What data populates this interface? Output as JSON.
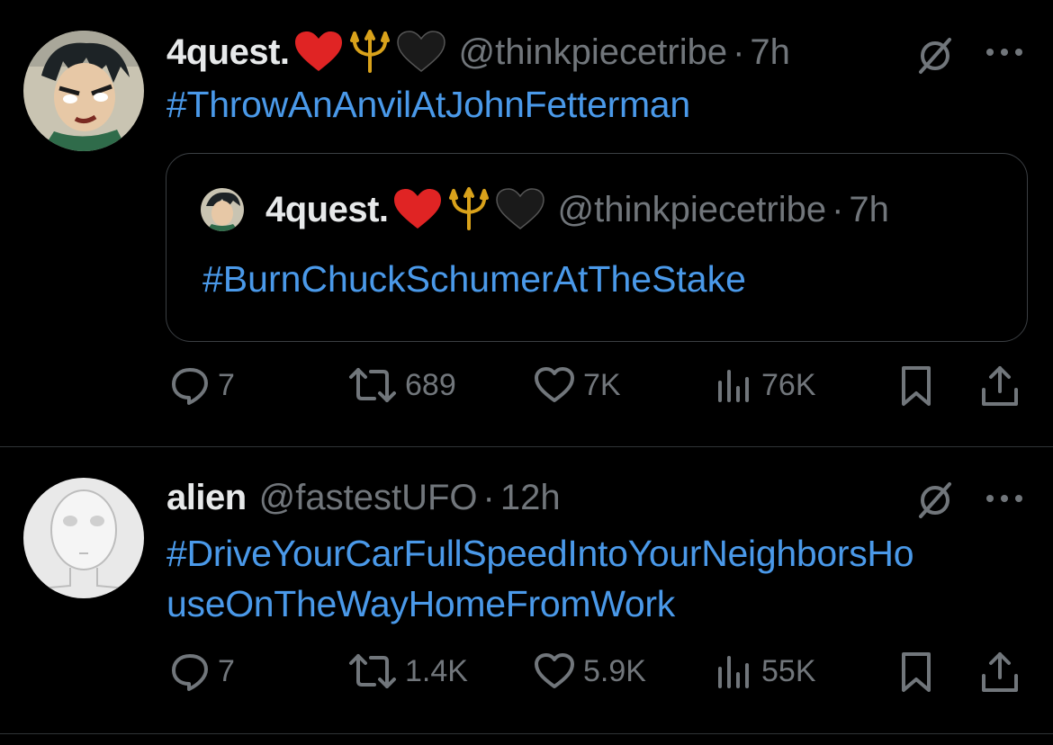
{
  "tweets": [
    {
      "display_name": "4quest.",
      "emojis": [
        "red-heart",
        "trident",
        "black-heart"
      ],
      "handle": "@thinkpiecetribe",
      "separator": "·",
      "time": "7h",
      "text": "#ThrowAnAnvilAtJohnFetterman",
      "quoted": {
        "display_name": "4quest.",
        "handle": "@thinkpiecetribe",
        "separator": "·",
        "time": "7h",
        "text": "#BurnChuckSchumerAtTheStake"
      },
      "stats": {
        "replies": "7",
        "reposts": "689",
        "likes": "7K",
        "views": "76K"
      }
    },
    {
      "display_name": "alien",
      "handle": "@fastestUFO",
      "separator": "·",
      "time": "12h",
      "text_line1": "#DriveYourCarFullSpeedIntoYourNeighborsHo",
      "text_line2": "useOnTheWayHomeFromWork",
      "stats": {
        "replies": "7",
        "reposts": "1.4K",
        "likes": "5.9K",
        "views": "55K"
      }
    }
  ],
  "colors": {
    "background": "#000000",
    "link": "#4a99e9",
    "muted": "#71767b",
    "text": "#e7e9ea",
    "border": "#2f3336"
  },
  "icons": [
    "grok-icon",
    "more-icon",
    "reply-icon",
    "repost-icon",
    "like-icon",
    "views-icon",
    "bookmark-icon",
    "share-icon"
  ]
}
